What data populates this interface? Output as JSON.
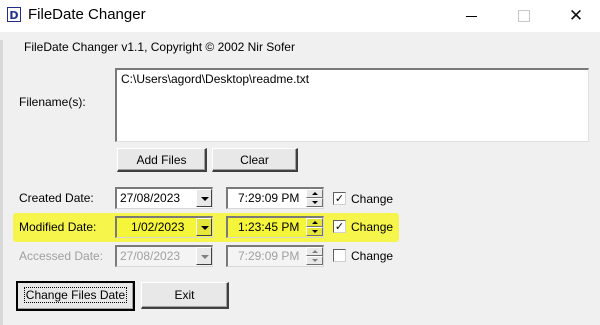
{
  "window": {
    "title": "FileDate Changer",
    "app_icon_letter": "D",
    "minimize_symbol": "—",
    "maximize_symbol": "☐",
    "close_symbol": "✕",
    "icons": [
      "app-icon",
      "minimize-icon",
      "maximize-icon",
      "close-icon"
    ]
  },
  "copyright": "FileDate Changer v1.1, Copyright © 2002 Nir Sofer",
  "filenames": {
    "label": "Filename(s):",
    "value": "C:\\Users\\agord\\Desktop\\readme.txt"
  },
  "buttons": {
    "add_files": "Add Files",
    "clear": "Clear",
    "change_files_date": "Change Files Date",
    "exit": "Exit"
  },
  "rows": {
    "created": {
      "label": "Created Date:",
      "date": "27/08/2023",
      "time": "7:29:09 PM",
      "change_label": "Change",
      "checked": true,
      "enabled": true
    },
    "modified": {
      "label": "Modified Date:",
      "date": "1/02/2023",
      "time": "1:23:45 PM",
      "change_label": "Change",
      "checked": true,
      "enabled": true
    },
    "accessed": {
      "label": "Accessed Date:",
      "date": "27/08/2023",
      "time": "7:29:09 PM",
      "change_label": "Change",
      "checked": false,
      "enabled": false
    }
  },
  "colors": {
    "highlight": "#f5f53a",
    "window_bg": "#f0f0f0",
    "disabled_text": "#a0a0a0"
  }
}
